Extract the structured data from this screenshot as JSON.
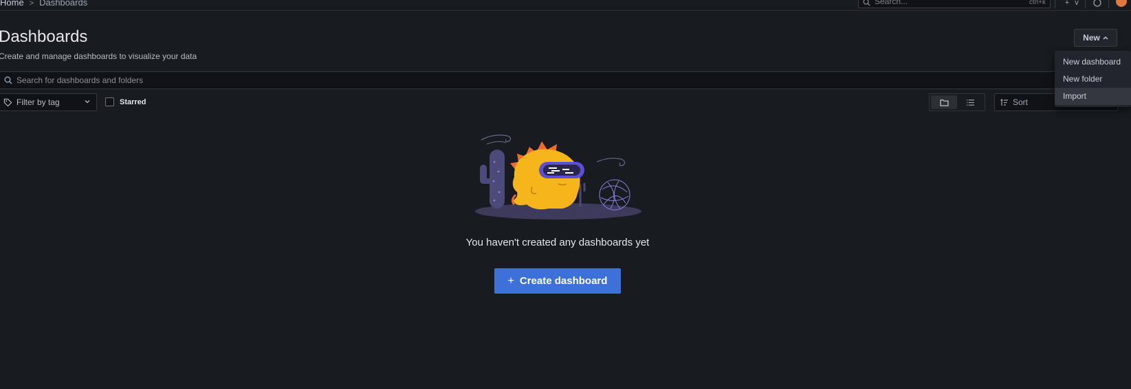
{
  "breadcrumb": {
    "home": "Home",
    "separator": ">",
    "current": "Dashboards"
  },
  "topbar": {
    "search_placeholder": "Search...",
    "search_shortcut": "ctrl+k",
    "plus_label": "+",
    "plus_chevron": "v",
    "help_icon": "help-icon"
  },
  "page": {
    "title": "Dashboards",
    "subtitle": "Create and manage dashboards to visualize your data"
  },
  "new_button": {
    "label": "New",
    "chevron": "^"
  },
  "new_menu": {
    "items": [
      "New dashboard",
      "New folder",
      "Import"
    ],
    "highlighted": "Import"
  },
  "search": {
    "placeholder": "Search for dashboards and folders"
  },
  "filters": {
    "tag_placeholder": "Filter by tag",
    "starred_label": "Starred",
    "starred_checked": false
  },
  "view_toggle": {
    "active": "folder-view",
    "options": [
      "folder-view",
      "list-view"
    ]
  },
  "sort": {
    "placeholder": "Sort"
  },
  "empty_state": {
    "message": "You haven't created any dashboards yet",
    "button_label": "Create dashboard",
    "button_icon": "+"
  },
  "colors": {
    "background": "#181b1f",
    "primary_button": "#3d71d9",
    "menu_bg": "#22252b",
    "mascot_yellow": "#f5b51b",
    "mascot_crest": "#f06a2a",
    "shadow_purple": "#3e3a5c"
  }
}
